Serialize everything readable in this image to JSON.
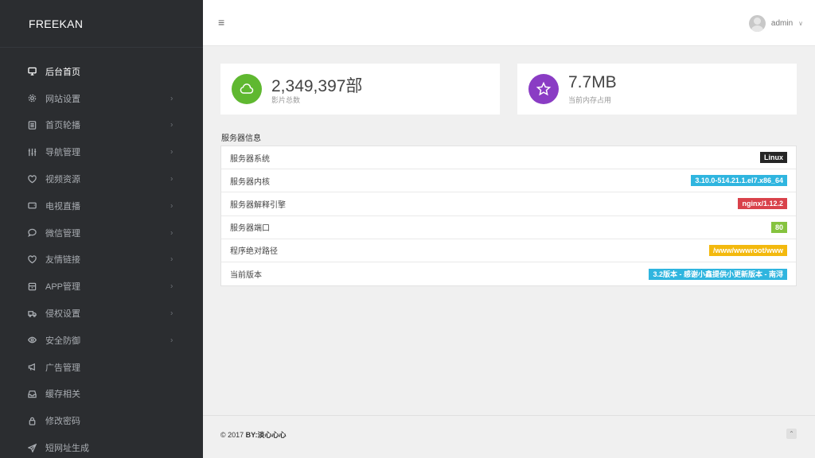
{
  "brand": "FREEKAN",
  "sidebar": {
    "items": [
      {
        "label": "后台首页",
        "icon": "monitor-icon",
        "active": true,
        "has_sub": false
      },
      {
        "label": "网站设置",
        "icon": "gear-icon",
        "active": false,
        "has_sub": true
      },
      {
        "label": "首页轮播",
        "icon": "slides-icon",
        "active": false,
        "has_sub": true
      },
      {
        "label": "导航管理",
        "icon": "sliders-icon",
        "active": false,
        "has_sub": true
      },
      {
        "label": "视频资源",
        "icon": "heart-icon",
        "active": false,
        "has_sub": true
      },
      {
        "label": "电视直播",
        "icon": "tv-icon",
        "active": false,
        "has_sub": true
      },
      {
        "label": "微信管理",
        "icon": "chat-icon",
        "active": false,
        "has_sub": true
      },
      {
        "label": "友情链接",
        "icon": "heart-icon",
        "active": false,
        "has_sub": true
      },
      {
        "label": "APP管理",
        "icon": "box-icon",
        "active": false,
        "has_sub": true
      },
      {
        "label": "侵权设置",
        "icon": "truck-icon",
        "active": false,
        "has_sub": true
      },
      {
        "label": "安全防御",
        "icon": "eye-icon",
        "active": false,
        "has_sub": true
      },
      {
        "label": "广告管理",
        "icon": "megaphone-icon",
        "active": false,
        "has_sub": false
      },
      {
        "label": "缓存相关",
        "icon": "inbox-icon",
        "active": false,
        "has_sub": false
      },
      {
        "label": "修改密码",
        "icon": "lock-icon",
        "active": false,
        "has_sub": false
      },
      {
        "label": "短网址生成",
        "icon": "send-icon",
        "active": false,
        "has_sub": false
      }
    ]
  },
  "header": {
    "user": "admin"
  },
  "stats": [
    {
      "value": "2,349,397部",
      "label": "影片总数",
      "color": "#5fb830",
      "icon": "cloud-icon"
    },
    {
      "value": "7.7MB",
      "label": "当前内存占用",
      "color": "#8a3cc4",
      "icon": "star-icon"
    }
  ],
  "server": {
    "title": "服务器信息",
    "rows": [
      {
        "label": "服务器系统",
        "value": "Linux",
        "color": "#262626"
      },
      {
        "label": "服务器内核",
        "value": "3.10.0-514.21.1.el7.x86_64",
        "color": "#2fb5df"
      },
      {
        "label": "服务器解释引擎",
        "value": "nginx/1.12.2",
        "color": "#d9424b"
      },
      {
        "label": "服务器端口",
        "value": "80",
        "color": "#86c33f"
      },
      {
        "label": "程序绝对路径",
        "value": "/www/wwwroot/www",
        "color": "#f3b90e"
      },
      {
        "label": "当前版本",
        "value": "3.2版本 - 感谢小鑫提供小更新版本 - 南浔",
        "color": "#2fb5df"
      }
    ]
  },
  "footer": {
    "copyright_prefix": "© 2017 ",
    "copyright_author": "BY:淡心心心"
  }
}
